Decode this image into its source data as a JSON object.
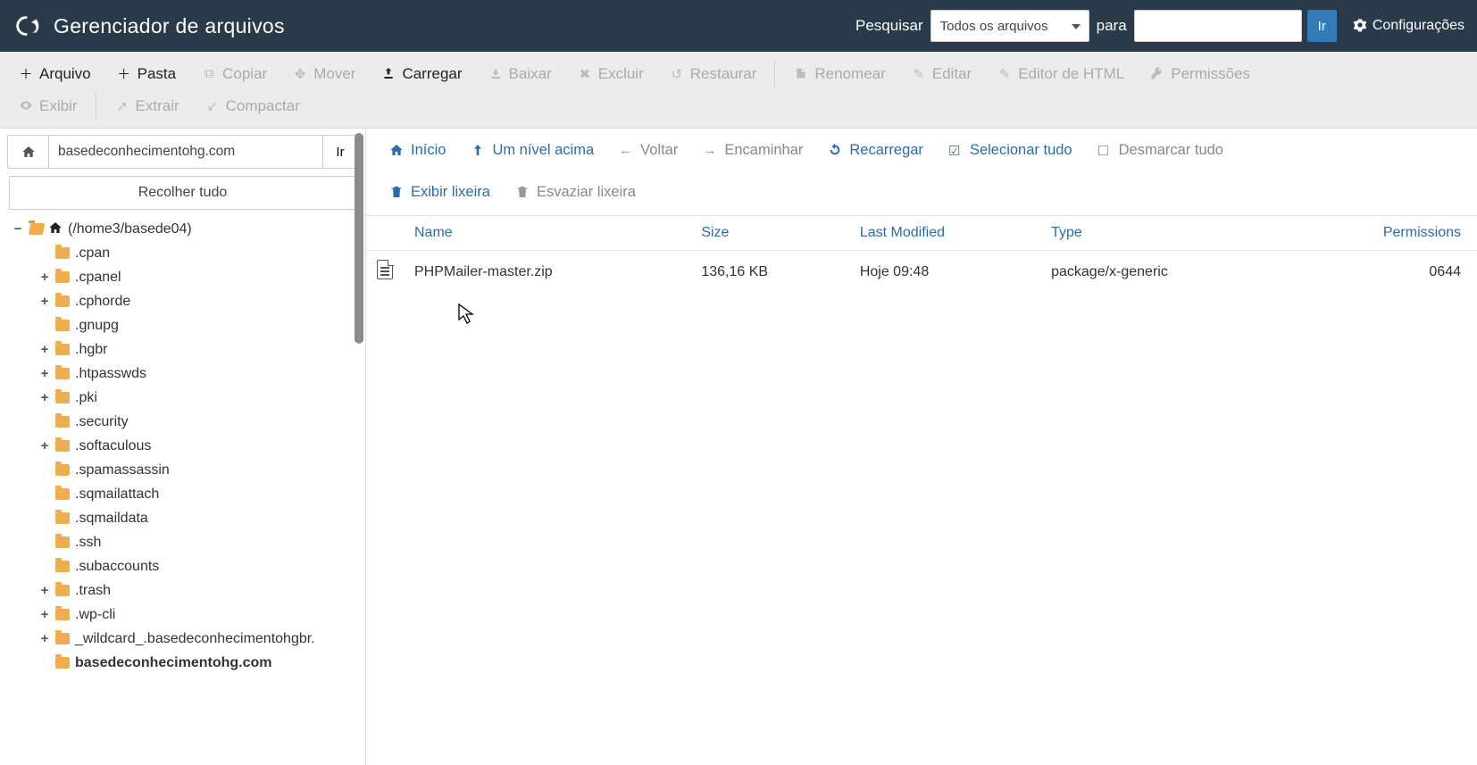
{
  "topbar": {
    "title": "Gerenciador de arquivos",
    "search_label": "Pesquisar",
    "select_value": "Todos os arquivos",
    "for_label": "para",
    "go_label": "Ir",
    "settings_label": "Configurações"
  },
  "toolbar": {
    "file": "Arquivo",
    "folder": "Pasta",
    "copy": "Copiar",
    "move": "Mover",
    "upload": "Carregar",
    "download": "Baixar",
    "delete": "Excluir",
    "restore": "Restaurar",
    "rename": "Renomear",
    "edit": "Editar",
    "html_editor": "Editor de HTML",
    "permissions": "Permissões",
    "view": "Exibir",
    "extract": "Extrair",
    "compress": "Compactar"
  },
  "sidebar": {
    "path_value": "basedeconhecimentohg.com",
    "go_label": "Ir",
    "collapse_label": "Recolher tudo",
    "root_label": "(/home3/basede04)",
    "items": [
      {
        "label": ".cpan",
        "expandable": false
      },
      {
        "label": ".cpanel",
        "expandable": true
      },
      {
        "label": ".cphorde",
        "expandable": true
      },
      {
        "label": ".gnupg",
        "expandable": false
      },
      {
        "label": ".hgbr",
        "expandable": true
      },
      {
        "label": ".htpasswds",
        "expandable": true
      },
      {
        "label": ".pki",
        "expandable": true
      },
      {
        "label": ".security",
        "expandable": false
      },
      {
        "label": ".softaculous",
        "expandable": true
      },
      {
        "label": ".spamassassin",
        "expandable": false
      },
      {
        "label": ".sqmailattach",
        "expandable": false
      },
      {
        "label": ".sqmaildata",
        "expandable": false
      },
      {
        "label": ".ssh",
        "expandable": false
      },
      {
        "label": ".subaccounts",
        "expandable": false
      },
      {
        "label": ".trash",
        "expandable": true
      },
      {
        "label": ".wp-cli",
        "expandable": true
      },
      {
        "label": "_wildcard_.basedeconhecimentohgbr.",
        "expandable": true
      },
      {
        "label": "basedeconhecimentohg.com",
        "expandable": false,
        "active": true
      }
    ]
  },
  "actionbar": {
    "home": "Início",
    "up": "Um nível acima",
    "back": "Voltar",
    "forward": "Encaminhar",
    "reload": "Recarregar",
    "select_all": "Selecionar tudo",
    "unselect_all": "Desmarcar tudo",
    "show_trash": "Exibir lixeira",
    "empty_trash": "Esvaziar lixeira"
  },
  "table": {
    "headers": {
      "name": "Name",
      "size": "Size",
      "modified": "Last Modified",
      "type": "Type",
      "perms": "Permissions"
    },
    "rows": [
      {
        "name": "PHPMailer-master.zip",
        "size": "136,16 KB",
        "modified": "Hoje 09:48",
        "type": "package/x-generic",
        "perms": "0644"
      }
    ]
  }
}
